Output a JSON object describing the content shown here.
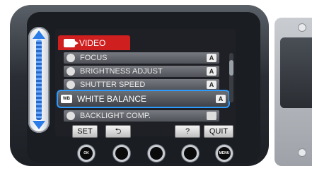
{
  "menu": {
    "title": "VIDEO",
    "items": [
      {
        "label": "FOCUS",
        "value": "A",
        "icon": "focus-icon"
      },
      {
        "label": "BRIGHTNESS ADJUST",
        "value": "A",
        "icon": "brightness-icon"
      },
      {
        "label": "SHUTTER SPEED",
        "value": "A",
        "icon": "shutter-icon"
      },
      {
        "label": "WHITE BALANCE",
        "value": "A",
        "icon": "white-balance-icon",
        "icon_text": "WB",
        "selected": true
      },
      {
        "label": "BACKLIGHT COMP.",
        "value": "",
        "icon": "backlight-icon"
      }
    ]
  },
  "buttons": {
    "set": "SET",
    "back": "⮌",
    "help": "?",
    "quit": "QUIT"
  },
  "hardware": {
    "ok": "OK",
    "menu": "MENU"
  }
}
